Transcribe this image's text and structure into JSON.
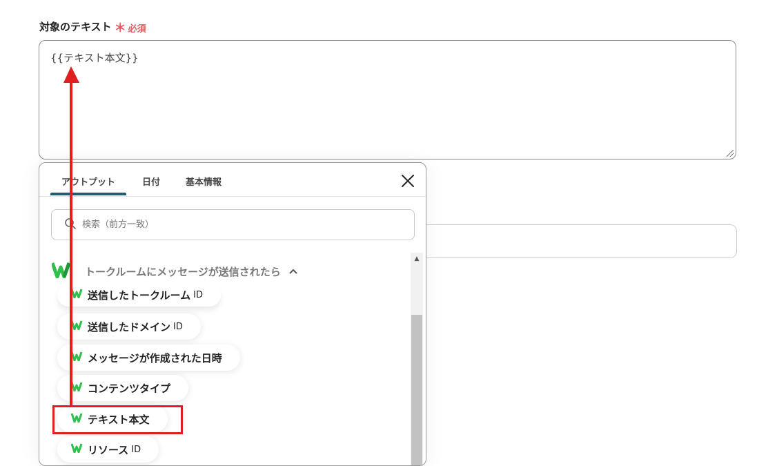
{
  "field": {
    "label": "対象のテキスト",
    "required_star": "＊",
    "required_text": "必須",
    "value": "{{テキスト本文}}"
  },
  "popup": {
    "tabs": [
      {
        "label": "アウトプット",
        "active": true
      },
      {
        "label": "日付",
        "active": false
      },
      {
        "label": "基本情報",
        "active": false
      }
    ],
    "search_placeholder": "検索（前方一致）",
    "group": {
      "title": "トークルームにメッセージが送信されたら",
      "expanded": true
    },
    "items": [
      {
        "label": "送信したトークルーム",
        "suffix": "ID"
      },
      {
        "label": "送信したドメイン",
        "suffix": "ID"
      },
      {
        "label": "メッセージが作成された日時",
        "suffix": ""
      },
      {
        "label": "コンテンツタイプ",
        "suffix": ""
      },
      {
        "label": "テキスト本文",
        "suffix": "",
        "highlighted": true
      },
      {
        "label": "リソース",
        "suffix": "ID"
      }
    ]
  },
  "colors": {
    "accent": "#1f5e75",
    "required": "#e45860",
    "annotation": "#e02020",
    "brand_green": "#2fbf4a"
  },
  "icons": [
    "close-icon",
    "search-icon",
    "chevron-up-icon",
    "service-logo-icon",
    "scroll-up-icon"
  ]
}
